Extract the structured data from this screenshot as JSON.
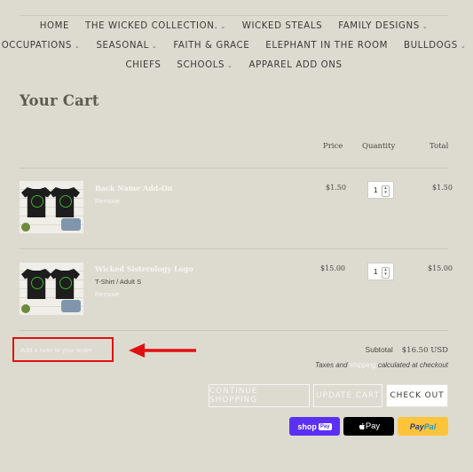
{
  "nav": {
    "row1": [
      {
        "label": "HOME",
        "has_menu": false
      },
      {
        "label": "THE WICKED COLLECTION.",
        "has_menu": true
      },
      {
        "label": "WICKED STEALS",
        "has_menu": false
      },
      {
        "label": "FAMILY DESIGNS",
        "has_menu": true
      }
    ],
    "row2": [
      {
        "label": "OCCUPATIONS",
        "has_menu": true
      },
      {
        "label": "SEASONAL",
        "has_menu": true
      },
      {
        "label": "FAITH & GRACE",
        "has_menu": false
      },
      {
        "label": "ELEPHANT IN THE ROOM",
        "has_menu": false
      },
      {
        "label": "BULLDOGS",
        "has_menu": true
      }
    ],
    "row3": [
      {
        "label": "CHIEFS",
        "has_menu": false
      },
      {
        "label": "SCHOOLS",
        "has_menu": true
      },
      {
        "label": "APPAREL ADD ONS",
        "has_menu": false
      }
    ],
    "chevron": "⌄"
  },
  "cart": {
    "title": "Your Cart",
    "headers": {
      "price": "Price",
      "quantity": "Quantity",
      "total": "Total"
    },
    "items": [
      {
        "name": "Back Name Add-On",
        "variant": "",
        "remove": "Remove",
        "price": "$1.50",
        "quantity": "1",
        "total": "$1.50"
      },
      {
        "name": "Wicked Sisterology Logo",
        "variant": "T-Shirt / Adult S",
        "remove": "Remove",
        "price": "$15.00",
        "quantity": "1",
        "total": "$15.00"
      }
    ],
    "note_placeholder": "Add a note to your order",
    "subtotal_label": "Subtotal",
    "subtotal_value": "$16.50 USD",
    "taxes_prefix": "Taxes and ",
    "taxes_link": "shipping",
    "taxes_suffix": " calculated at checkout",
    "buttons": {
      "continue": "CONTINUE SHOPPING",
      "update": "UPDATE CART",
      "checkout": "CHECK OUT"
    },
    "payments": {
      "shop_pay": "shop",
      "shop_pay_box": "Pay",
      "apple_pay": " Pay",
      "paypal_pay": "Pay",
      "paypal_pal": "Pal"
    }
  },
  "colors": {
    "background": "#dddbd0",
    "annotation": "#e01010",
    "shop_pay": "#5a31f4",
    "paypal": "#ffc439"
  },
  "icons": [
    "chevron-down-icon",
    "arrow-annotation-icon",
    "apple-logo-icon"
  ]
}
